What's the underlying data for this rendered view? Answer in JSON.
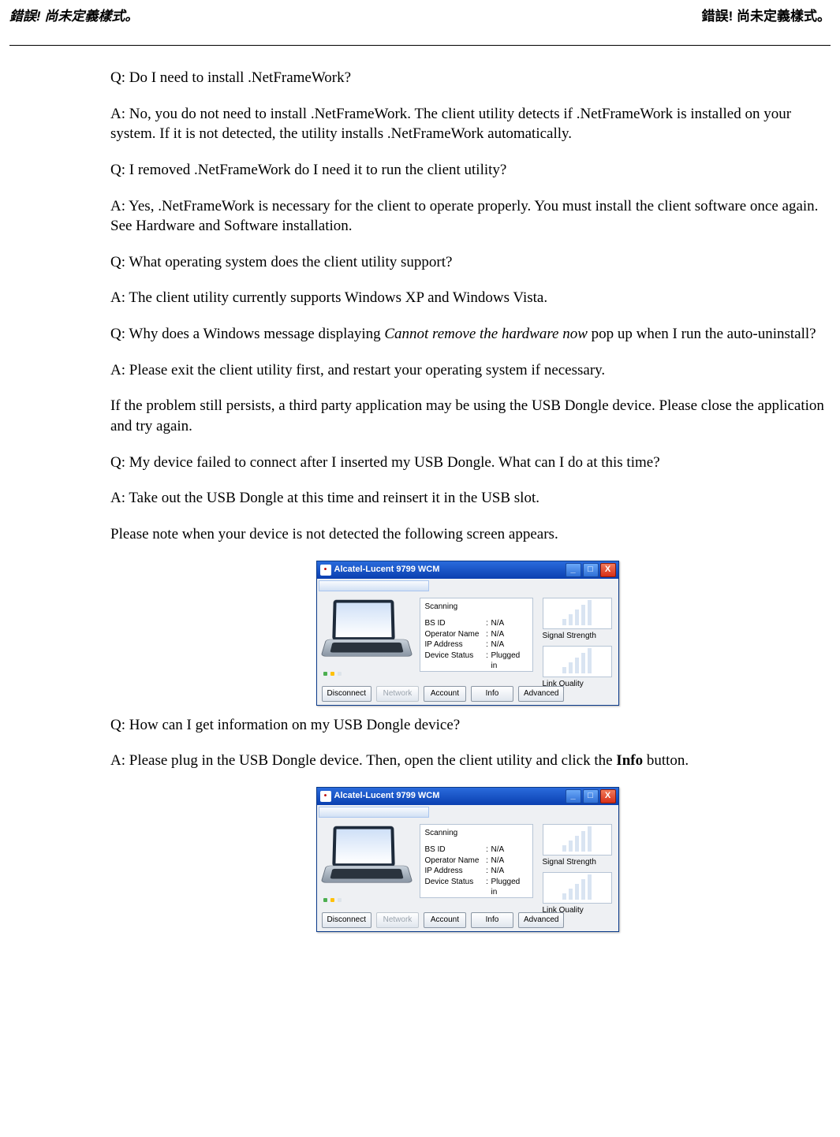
{
  "header": {
    "left": "錯誤! 尚未定義樣式。",
    "right": "錯誤! 尚未定義樣式。"
  },
  "faq": [
    {
      "q": "Q: Do I need to install .NetFrameWork?",
      "a": [
        "A: No, you do not need to install .NetFrameWork. The client utility detects if .NetFrameWork is installed on your system. If it is not detected, the utility installs .NetFrameWork automatically."
      ]
    },
    {
      "q": "Q: I removed .NetFrameWork do I need it to run the client utility?",
      "a": [
        "A: Yes, .NetFrameWork is necessary for the client to operate properly. You must install the client software once again. See Hardware and Software installation."
      ]
    },
    {
      "q": "Q: What operating system does the client utility support?",
      "a": [
        "A: The client utility currently supports Windows XP and Windows Vista."
      ]
    },
    {
      "q_parts": [
        {
          "t": "Q: Why does a Windows message displaying "
        },
        {
          "t": "Cannot remove the hardware now",
          "it": true
        },
        {
          "t": " pop up when I run the auto-uninstall?"
        }
      ],
      "a": [
        "A: Please exit the client utility first, and restart your operating system if necessary.",
        "If the problem still persists, a third party application may be using the USB Dongle device. Please close the application and try again."
      ]
    },
    {
      "q": "Q: My device failed to connect after I inserted my USB Dongle. What can I do at this time?",
      "a": [
        "A: Take out the USB Dongle at this time and reinsert it in the USB slot.",
        "Please note when your device is not detected the following screen appears."
      ],
      "fig": true
    },
    {
      "q": "Q: How can I get information on my USB Dongle device?",
      "a_parts": [
        {
          "t": "A: Please plug in the USB Dongle device. Then, open the client utility and click the "
        },
        {
          "t": "Info",
          "b": true
        },
        {
          "t": " button."
        }
      ],
      "fig": true
    }
  ],
  "wcm": {
    "title": "Alcatel-Lucent 9799 WCM",
    "status": "Scanning",
    "fields": {
      "bsid": {
        "label": "BS ID",
        "value": "N/A"
      },
      "op": {
        "label": "Operator Name",
        "value": "N/A"
      },
      "ip": {
        "label": "IP Address",
        "value": "N/A"
      },
      "dev": {
        "label": "Device Status",
        "value": "Plugged in"
      }
    },
    "meters": {
      "signal": "Signal Strength",
      "link": "Link Quality"
    },
    "buttons": {
      "disconnect": "Disconnect",
      "network": "Network",
      "account": "Account",
      "info": "Info",
      "advanced": "Advanced"
    }
  }
}
